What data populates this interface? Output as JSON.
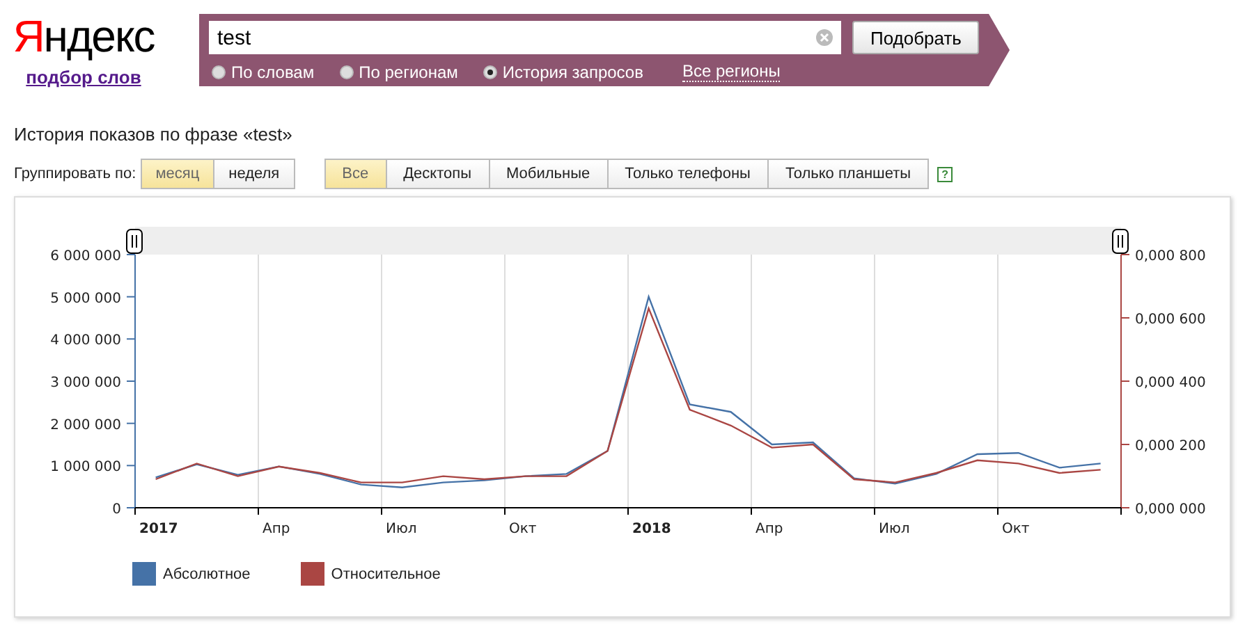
{
  "logo": {
    "first_letter": "Я",
    "rest": "ндекс"
  },
  "subtitle_link": "подбор слов",
  "search": {
    "value": "test",
    "button": "Подобрать",
    "modes": [
      {
        "label": "По словам",
        "selected": false
      },
      {
        "label": "По регионам",
        "selected": false
      },
      {
        "label": "История запросов",
        "selected": true
      }
    ],
    "regions_link": "Все регионы"
  },
  "heading": "История показов по фразе «test»",
  "grouping": {
    "label": "Группировать по:",
    "options": [
      {
        "label": "месяц",
        "selected": true
      },
      {
        "label": "неделя",
        "selected": false
      }
    ]
  },
  "devices": [
    {
      "label": "Все",
      "selected": true
    },
    {
      "label": "Десктопы",
      "selected": false
    },
    {
      "label": "Мобильные",
      "selected": false
    },
    {
      "label": "Только телефоны",
      "selected": false
    },
    {
      "label": "Только планшеты",
      "selected": false
    }
  ],
  "help": "?",
  "chart": {
    "chart_data": {
      "type": "line",
      "categories": [
        "2017",
        null,
        null,
        "Апр",
        null,
        null,
        "Июл",
        null,
        null,
        "Окт",
        null,
        null,
        "2018",
        null,
        null,
        "Апр",
        null,
        null,
        "Июл",
        null,
        null,
        "Окт",
        null,
        null
      ],
      "ylim": [
        0,
        6000000
      ],
      "yticks": [
        {
          "value": 0,
          "label": "0"
        },
        {
          "value": 1000000,
          "label": "1 000 000"
        },
        {
          "value": 2000000,
          "label": "2 000 000"
        },
        {
          "value": 3000000,
          "label": "3 000 000"
        },
        {
          "value": 4000000,
          "label": "4 000 000"
        },
        {
          "value": 5000000,
          "label": "5 000 000"
        },
        {
          "value": 6000000,
          "label": "6 000 000"
        }
      ],
      "y2lim": [
        0,
        0.0008
      ],
      "y2ticks": [
        {
          "value": 0,
          "label": "0,000 000"
        },
        {
          "value": 0.0002,
          "label": "0,000 200"
        },
        {
          "value": 0.0004,
          "label": "0,000 400"
        },
        {
          "value": 0.0006,
          "label": "0,000 600"
        },
        {
          "value": 0.0008,
          "label": "0,000 800"
        }
      ],
      "series": [
        {
          "name": "Абсолютное",
          "color": "#4572a7",
          "values": [
            720000,
            1030000,
            780000,
            980000,
            800000,
            550000,
            480000,
            600000,
            650000,
            750000,
            800000,
            1350000,
            5000000,
            2450000,
            2270000,
            1500000,
            1550000,
            700000,
            570000,
            800000,
            1270000,
            1300000,
            950000,
            1050000
          ]
        },
        {
          "name": "Относительное",
          "color": "#aa4643",
          "axis": "y2",
          "values": [
            9e-05,
            0.00014,
            0.0001,
            0.00013,
            0.00011,
            8e-05,
            8e-05,
            0.0001,
            9e-05,
            0.0001,
            0.0001,
            0.00018,
            0.00063,
            0.00031,
            0.00026,
            0.00019,
            0.0002,
            9e-05,
            8e-05,
            0.00011,
            0.00015,
            0.00014,
            0.00011,
            0.00012
          ]
        }
      ]
    }
  }
}
